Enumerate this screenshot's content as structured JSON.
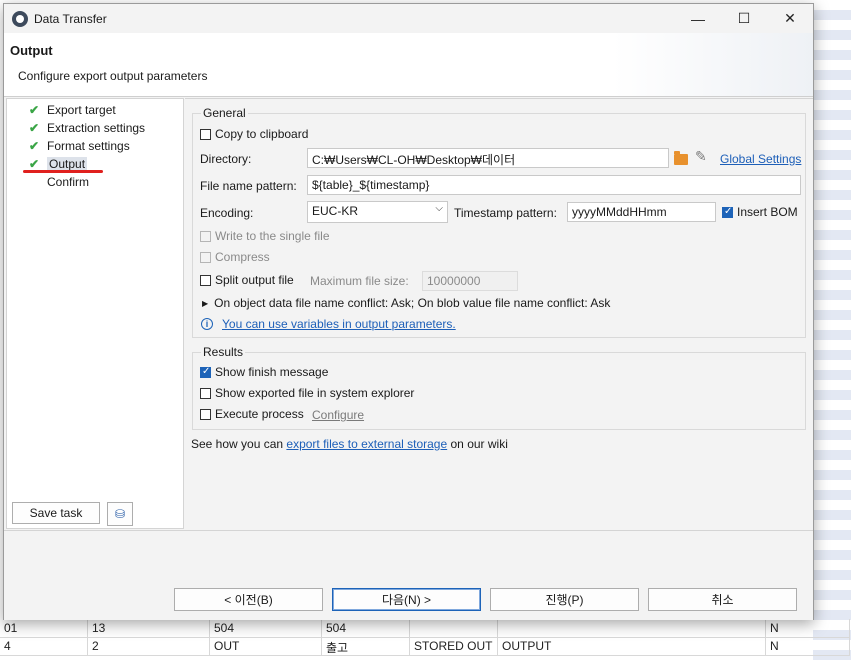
{
  "background_rows": [
    {
      "c0": "01",
      "c1": "13",
      "c2": "504",
      "c3": "504",
      "c4": "",
      "c5": "",
      "c6": "N"
    },
    {
      "c0": "4",
      "c1": "2",
      "c2": "OUT",
      "c3": "출고",
      "c4": "STORED OUT",
      "c5": "OUTPUT",
      "c6": "N"
    }
  ],
  "window": {
    "title": "Data Transfer",
    "minimize_glyph": "—",
    "maximize_glyph": "☐",
    "close_glyph": "✕"
  },
  "header": {
    "title": "Output",
    "subtitle": "Configure export output parameters"
  },
  "nav": {
    "items": [
      {
        "label": "Export target",
        "done": true
      },
      {
        "label": "Extraction settings",
        "done": true
      },
      {
        "label": "Format settings",
        "done": true
      },
      {
        "label": "Output",
        "done": true
      },
      {
        "label": "Confirm",
        "done": false
      }
    ],
    "check_glyph": "✔"
  },
  "left_buttons": {
    "save_task": "Save task",
    "task_icon": "⛁"
  },
  "general": {
    "title": "General",
    "copy_to_clipboard": {
      "label": "Copy to clipboard",
      "checked": false
    },
    "directory_label": "Directory:",
    "directory_value": "C:₩Users₩CL-OH₩Desktop₩데이터",
    "global_settings_link": "Global Settings",
    "file_name_label": "File name pattern:",
    "file_name_value": "${table}_${timestamp}",
    "encoding_label": "Encoding:",
    "encoding_value": "EUC-KR",
    "timestamp_label": "Timestamp pattern:",
    "timestamp_value": "yyyyMMddHHmm",
    "insert_bom": {
      "label": "Insert BOM",
      "checked": true
    },
    "write_single_file": {
      "label": "Write to the single file",
      "checked": false,
      "enabled": false
    },
    "compress": {
      "label": "Compress",
      "checked": false,
      "enabled": false
    },
    "split_output": {
      "label": "Split output file",
      "checked": false
    },
    "max_file_size_label": "Maximum file size:",
    "max_file_size_value": "10000000",
    "conflict_expander": "On object data file name conflict: Ask; On blob value file name conflict: Ask",
    "expander_glyph": "▶",
    "variables_link": "You can use variables in output parameters.",
    "info_glyph": "i"
  },
  "results": {
    "title": "Results",
    "show_finish": {
      "label": "Show finish message",
      "checked": true
    },
    "show_explorer": {
      "label": "Show exported file in system explorer",
      "checked": false
    },
    "execute_process": {
      "label": "Execute process",
      "checked": false
    },
    "configure_link": "Configure"
  },
  "wiki": {
    "prefix": "See how you can ",
    "link": "export files to external storage",
    "suffix": " on our wiki"
  },
  "footer": {
    "back": "< 이전(B)",
    "next": "다음(N) >",
    "proceed": "진행(P)",
    "cancel": "취소"
  },
  "colors": {
    "accent": "#1d63b8",
    "check_green": "#3aa546",
    "underline_red": "#e0201e",
    "folder_orange": "#e8912d"
  }
}
